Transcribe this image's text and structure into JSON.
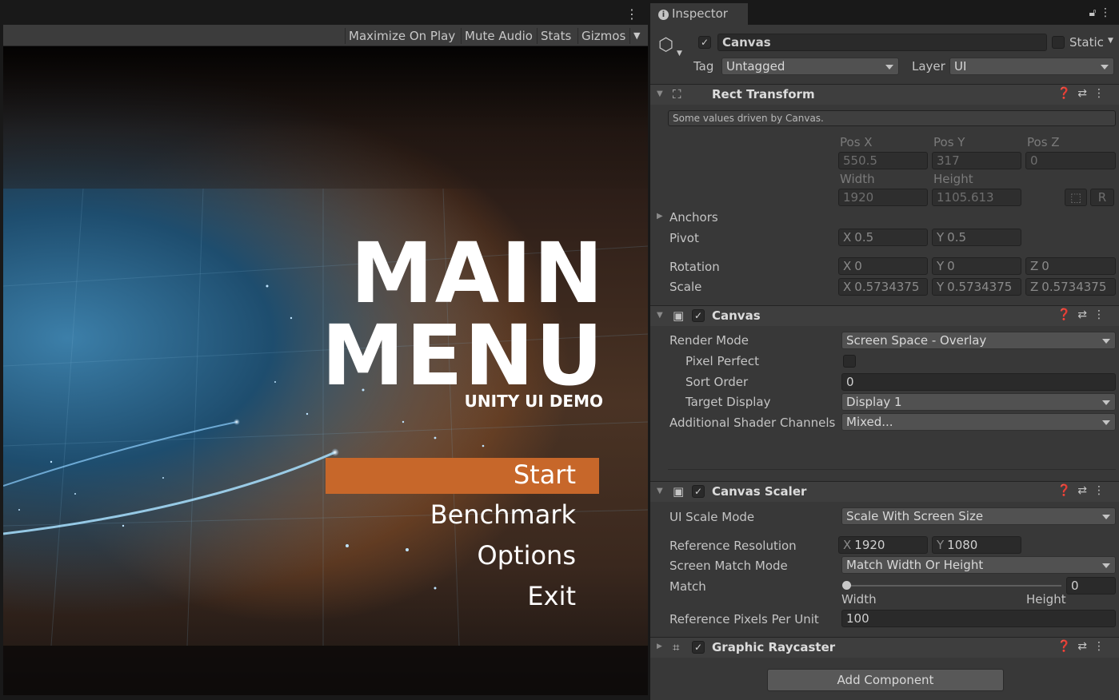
{
  "game_view": {
    "toolbar": {
      "maximize_on_play": "Maximize On Play",
      "mute_audio": "Mute Audio",
      "stats": "Stats",
      "gizmos": "Gizmos"
    },
    "title_line1": "MAIN",
    "title_line2": "MENU",
    "subtitle": "UNITY UI DEMO",
    "menu": {
      "start": "Start",
      "benchmark": "Benchmark",
      "options": "Options",
      "exit": "Exit"
    },
    "accent_color": "#c7672a"
  },
  "inspector": {
    "tab_label": "Inspector",
    "object": {
      "name": "Canvas",
      "static_label": "Static",
      "tag_label": "Tag",
      "tag_value": "Untagged",
      "layer_label": "Layer",
      "layer_value": "UI"
    },
    "rect_transform": {
      "title": "Rect Transform",
      "driven_note": "Some values driven by Canvas.",
      "pos_x_label": "Pos X",
      "pos_y_label": "Pos Y",
      "pos_z_label": "Pos Z",
      "pos_x": "550.5",
      "pos_y": "317",
      "pos_z": "0",
      "width_label": "Width",
      "height_label": "Height",
      "width": "1920",
      "height": "1105.613",
      "r_button": "R",
      "anchors_label": "Anchors",
      "pivot_label": "Pivot",
      "pivot_x": "0.5",
      "pivot_y": "0.5",
      "rotation_label": "Rotation",
      "rot_x": "0",
      "rot_y": "0",
      "rot_z": "0",
      "scale_label": "Scale",
      "scale_x": "0.5734375",
      "scale_y": "0.5734375",
      "scale_z": "0.5734375",
      "axis_x": "X",
      "axis_y": "Y",
      "axis_z": "Z"
    },
    "canvas": {
      "title": "Canvas",
      "render_mode_label": "Render Mode",
      "render_mode": "Screen Space - Overlay",
      "pixel_perfect_label": "Pixel Perfect",
      "sort_order_label": "Sort Order",
      "sort_order": "0",
      "target_display_label": "Target Display",
      "target_display": "Display 1",
      "shader_channels_label": "Additional Shader Channels",
      "shader_channels": "Mixed..."
    },
    "canvas_scaler": {
      "title": "Canvas Scaler",
      "ui_scale_mode_label": "UI Scale Mode",
      "ui_scale_mode": "Scale With Screen Size",
      "ref_resolution_label": "Reference Resolution",
      "ref_x": "1920",
      "ref_y": "1080",
      "match_mode_label": "Screen Match Mode",
      "match_mode": "Match Width Or Height",
      "match_label": "Match",
      "match_value": "0",
      "match_left": "Width",
      "match_right": "Height",
      "ref_ppu_label": "Reference Pixels Per Unit",
      "ref_ppu": "100"
    },
    "graphic_raycaster": {
      "title": "Graphic Raycaster"
    },
    "add_component": "Add Component"
  }
}
